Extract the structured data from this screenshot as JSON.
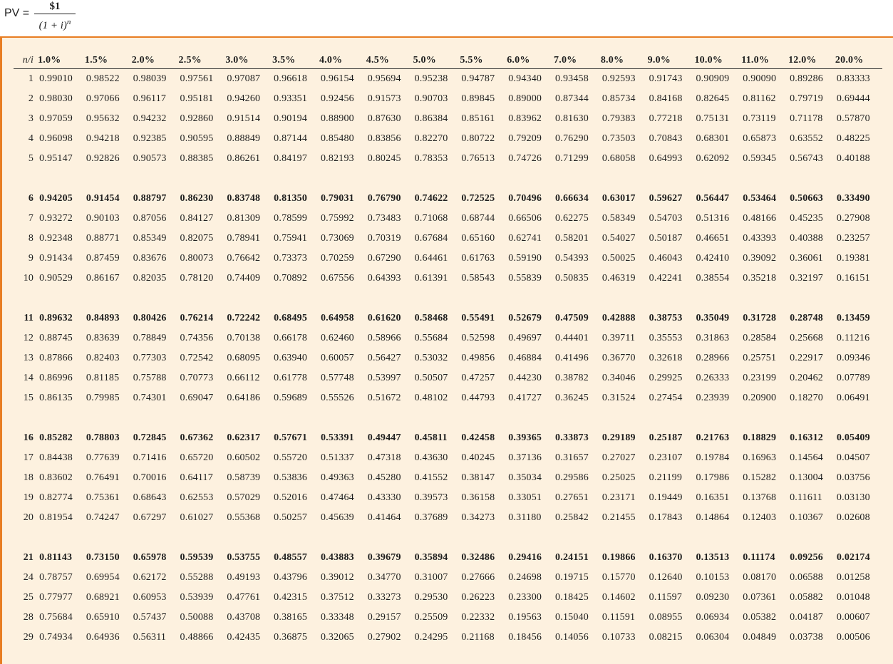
{
  "formula": {
    "lhs": "PV =",
    "numerator": "$1",
    "denominator": "(1 + i)",
    "exponent": "n"
  },
  "table": {
    "corner_label": "n/i",
    "rates": [
      "1.0%",
      "1.5%",
      "2.0%",
      "2.5%",
      "3.0%",
      "3.5%",
      "4.0%",
      "4.5%",
      "5.0%",
      "5.5%",
      "6.0%",
      "7.0%",
      "8.0%",
      "9.0%",
      "10.0%",
      "11.0%",
      "12.0%",
      "20.0%"
    ],
    "groups": [
      [
        {
          "n": "1",
          "bold": false,
          "values": [
            "0.99010",
            "0.98522",
            "0.98039",
            "0.97561",
            "0.97087",
            "0.96618",
            "0.96154",
            "0.95694",
            "0.95238",
            "0.94787",
            "0.94340",
            "0.93458",
            "0.92593",
            "0.91743",
            "0.90909",
            "0.90090",
            "0.89286",
            "0.83333"
          ]
        },
        {
          "n": "2",
          "bold": false,
          "values": [
            "0.98030",
            "0.97066",
            "0.96117",
            "0.95181",
            "0.94260",
            "0.93351",
            "0.92456",
            "0.91573",
            "0.90703",
            "0.89845",
            "0.89000",
            "0.87344",
            "0.85734",
            "0.84168",
            "0.82645",
            "0.81162",
            "0.79719",
            "0.69444"
          ]
        },
        {
          "n": "3",
          "bold": false,
          "values": [
            "0.97059",
            "0.95632",
            "0.94232",
            "0.92860",
            "0.91514",
            "0.90194",
            "0.88900",
            "0.87630",
            "0.86384",
            "0.85161",
            "0.83962",
            "0.81630",
            "0.79383",
            "0.77218",
            "0.75131",
            "0.73119",
            "0.71178",
            "0.57870"
          ]
        },
        {
          "n": "4",
          "bold": false,
          "values": [
            "0.96098",
            "0.94218",
            "0.92385",
            "0.90595",
            "0.88849",
            "0.87144",
            "0.85480",
            "0.83856",
            "0.82270",
            "0.80722",
            "0.79209",
            "0.76290",
            "0.73503",
            "0.70843",
            "0.68301",
            "0.65873",
            "0.63552",
            "0.48225"
          ]
        },
        {
          "n": "5",
          "bold": false,
          "values": [
            "0.95147",
            "0.92826",
            "0.90573",
            "0.88385",
            "0.86261",
            "0.84197",
            "0.82193",
            "0.80245",
            "0.78353",
            "0.76513",
            "0.74726",
            "0.71299",
            "0.68058",
            "0.64993",
            "0.62092",
            "0.59345",
            "0.56743",
            "0.40188"
          ]
        }
      ],
      [
        {
          "n": "6",
          "bold": true,
          "values": [
            "0.94205",
            "0.91454",
            "0.88797",
            "0.86230",
            "0.83748",
            "0.81350",
            "0.79031",
            "0.76790",
            "0.74622",
            "0.72525",
            "0.70496",
            "0.66634",
            "0.63017",
            "0.59627",
            "0.56447",
            "0.53464",
            "0.50663",
            "0.33490"
          ]
        },
        {
          "n": "7",
          "bold": false,
          "values": [
            "0.93272",
            "0.90103",
            "0.87056",
            "0.84127",
            "0.81309",
            "0.78599",
            "0.75992",
            "0.73483",
            "0.71068",
            "0.68744",
            "0.66506",
            "0.62275",
            "0.58349",
            "0.54703",
            "0.51316",
            "0.48166",
            "0.45235",
            "0.27908"
          ]
        },
        {
          "n": "8",
          "bold": false,
          "values": [
            "0.92348",
            "0.88771",
            "0.85349",
            "0.82075",
            "0.78941",
            "0.75941",
            "0.73069",
            "0.70319",
            "0.67684",
            "0.65160",
            "0.62741",
            "0.58201",
            "0.54027",
            "0.50187",
            "0.46651",
            "0.43393",
            "0.40388",
            "0.23257"
          ]
        },
        {
          "n": "9",
          "bold": false,
          "values": [
            "0.91434",
            "0.87459",
            "0.83676",
            "0.80073",
            "0.76642",
            "0.73373",
            "0.70259",
            "0.67290",
            "0.64461",
            "0.61763",
            "0.59190",
            "0.54393",
            "0.50025",
            "0.46043",
            "0.42410",
            "0.39092",
            "0.36061",
            "0.19381"
          ]
        },
        {
          "n": "10",
          "bold": false,
          "values": [
            "0.90529",
            "0.86167",
            "0.82035",
            "0.78120",
            "0.74409",
            "0.70892",
            "0.67556",
            "0.64393",
            "0.61391",
            "0.58543",
            "0.55839",
            "0.50835",
            "0.46319",
            "0.42241",
            "0.38554",
            "0.35218",
            "0.32197",
            "0.16151"
          ]
        }
      ],
      [
        {
          "n": "11",
          "bold": true,
          "values": [
            "0.89632",
            "0.84893",
            "0.80426",
            "0.76214",
            "0.72242",
            "0.68495",
            "0.64958",
            "0.61620",
            "0.58468",
            "0.55491",
            "0.52679",
            "0.47509",
            "0.42888",
            "0.38753",
            "0.35049",
            "0.31728",
            "0.28748",
            "0.13459"
          ]
        },
        {
          "n": "12",
          "bold": false,
          "values": [
            "0.88745",
            "0.83639",
            "0.78849",
            "0.74356",
            "0.70138",
            "0.66178",
            "0.62460",
            "0.58966",
            "0.55684",
            "0.52598",
            "0.49697",
            "0.44401",
            "0.39711",
            "0.35553",
            "0.31863",
            "0.28584",
            "0.25668",
            "0.11216"
          ]
        },
        {
          "n": "13",
          "bold": false,
          "values": [
            "0.87866",
            "0.82403",
            "0.77303",
            "0.72542",
            "0.68095",
            "0.63940",
            "0.60057",
            "0.56427",
            "0.53032",
            "0.49856",
            "0.46884",
            "0.41496",
            "0.36770",
            "0.32618",
            "0.28966",
            "0.25751",
            "0.22917",
            "0.09346"
          ]
        },
        {
          "n": "14",
          "bold": false,
          "values": [
            "0.86996",
            "0.81185",
            "0.75788",
            "0.70773",
            "0.66112",
            "0.61778",
            "0.57748",
            "0.53997",
            "0.50507",
            "0.47257",
            "0.44230",
            "0.38782",
            "0.34046",
            "0.29925",
            "0.26333",
            "0.23199",
            "0.20462",
            "0.07789"
          ]
        },
        {
          "n": "15",
          "bold": false,
          "values": [
            "0.86135",
            "0.79985",
            "0.74301",
            "0.69047",
            "0.64186",
            "0.59689",
            "0.55526",
            "0.51672",
            "0.48102",
            "0.44793",
            "0.41727",
            "0.36245",
            "0.31524",
            "0.27454",
            "0.23939",
            "0.20900",
            "0.18270",
            "0.06491"
          ]
        }
      ],
      [
        {
          "n": "16",
          "bold": true,
          "values": [
            "0.85282",
            "0.78803",
            "0.72845",
            "0.67362",
            "0.62317",
            "0.57671",
            "0.53391",
            "0.49447",
            "0.45811",
            "0.42458",
            "0.39365",
            "0.33873",
            "0.29189",
            "0.25187",
            "0.21763",
            "0.18829",
            "0.16312",
            "0.05409"
          ]
        },
        {
          "n": "17",
          "bold": false,
          "values": [
            "0.84438",
            "0.77639",
            "0.71416",
            "0.65720",
            "0.60502",
            "0.55720",
            "0.51337",
            "0.47318",
            "0.43630",
            "0.40245",
            "0.37136",
            "0.31657",
            "0.27027",
            "0.23107",
            "0.19784",
            "0.16963",
            "0.14564",
            "0.04507"
          ]
        },
        {
          "n": "18",
          "bold": false,
          "values": [
            "0.83602",
            "0.76491",
            "0.70016",
            "0.64117",
            "0.58739",
            "0.53836",
            "0.49363",
            "0.45280",
            "0.41552",
            "0.38147",
            "0.35034",
            "0.29586",
            "0.25025",
            "0.21199",
            "0.17986",
            "0.15282",
            "0.13004",
            "0.03756"
          ]
        },
        {
          "n": "19",
          "bold": false,
          "values": [
            "0.82774",
            "0.75361",
            "0.68643",
            "0.62553",
            "0.57029",
            "0.52016",
            "0.47464",
            "0.43330",
            "0.39573",
            "0.36158",
            "0.33051",
            "0.27651",
            "0.23171",
            "0.19449",
            "0.16351",
            "0.13768",
            "0.11611",
            "0.03130"
          ]
        },
        {
          "n": "20",
          "bold": false,
          "values": [
            "0.81954",
            "0.74247",
            "0.67297",
            "0.61027",
            "0.55368",
            "0.50257",
            "0.45639",
            "0.41464",
            "0.37689",
            "0.34273",
            "0.31180",
            "0.25842",
            "0.21455",
            "0.17843",
            "0.14864",
            "0.12403",
            "0.10367",
            "0.02608"
          ]
        }
      ],
      [
        {
          "n": "21",
          "bold": true,
          "values": [
            "0.81143",
            "0.73150",
            "0.65978",
            "0.59539",
            "0.53755",
            "0.48557",
            "0.43883",
            "0.39679",
            "0.35894",
            "0.32486",
            "0.29416",
            "0.24151",
            "0.19866",
            "0.16370",
            "0.13513",
            "0.11174",
            "0.09256",
            "0.02174"
          ]
        },
        {
          "n": "24",
          "bold": false,
          "values": [
            "0.78757",
            "0.69954",
            "0.62172",
            "0.55288",
            "0.49193",
            "0.43796",
            "0.39012",
            "0.34770",
            "0.31007",
            "0.27666",
            "0.24698",
            "0.19715",
            "0.15770",
            "0.12640",
            "0.10153",
            "0.08170",
            "0.06588",
            "0.01258"
          ]
        },
        {
          "n": "25",
          "bold": false,
          "values": [
            "0.77977",
            "0.68921",
            "0.60953",
            "0.53939",
            "0.47761",
            "0.42315",
            "0.37512",
            "0.33273",
            "0.29530",
            "0.26223",
            "0.23300",
            "0.18425",
            "0.14602",
            "0.11597",
            "0.09230",
            "0.07361",
            "0.05882",
            "0.01048"
          ]
        },
        {
          "n": "28",
          "bold": false,
          "values": [
            "0.75684",
            "0.65910",
            "0.57437",
            "0.50088",
            "0.43708",
            "0.38165",
            "0.33348",
            "0.29157",
            "0.25509",
            "0.22332",
            "0.19563",
            "0.15040",
            "0.11591",
            "0.08955",
            "0.06934",
            "0.05382",
            "0.04187",
            "0.00607"
          ]
        },
        {
          "n": "29",
          "bold": false,
          "values": [
            "0.74934",
            "0.64936",
            "0.56311",
            "0.48866",
            "0.42435",
            "0.36875",
            "0.32065",
            "0.27902",
            "0.24295",
            "0.21168",
            "0.18456",
            "0.14056",
            "0.10733",
            "0.08215",
            "0.06304",
            "0.04849",
            "0.03738",
            "0.00506"
          ]
        }
      ]
    ]
  },
  "colors": {
    "page_background": "#fdf1df",
    "header_background": "#ffffff",
    "accent_rule": "#e87d22"
  }
}
